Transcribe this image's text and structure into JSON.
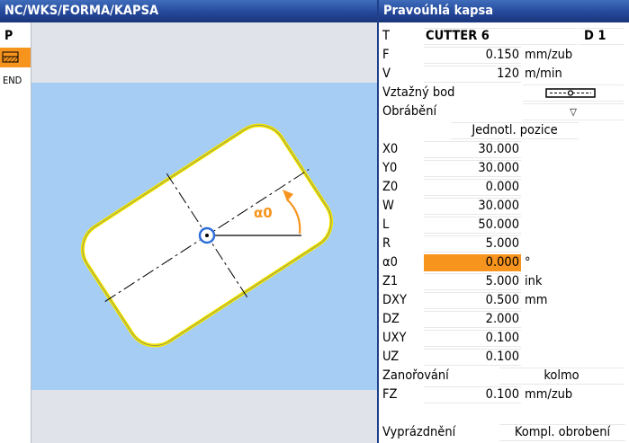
{
  "header": {
    "left_title": "NC/WKS/FORMA/KAPSA",
    "right_title": "Pravoúhlá kapsa"
  },
  "strip": {
    "p_label": "P",
    "pocket_icon": "pocket-milling-icon",
    "end_label": "END"
  },
  "graphic": {
    "angle_label": "α0"
  },
  "params": {
    "tool": {
      "label": "T",
      "value": "CUTTER 6",
      "edge": "D 1"
    },
    "feed": {
      "label": "F",
      "value": "0.150",
      "unit": "mm/zub"
    },
    "speed": {
      "label": "V",
      "value": "120",
      "unit": "m/min"
    },
    "reference_point": {
      "label": "Vztažný bod",
      "icon": "reference-point-center-icon"
    },
    "machining": {
      "label": "Obrábění",
      "icon": "chevron-down-icon",
      "value": "▽"
    },
    "position_mode": {
      "value": "Jednotl. pozice"
    },
    "x0": {
      "label": "X0",
      "value": "30.000"
    },
    "y0": {
      "label": "Y0",
      "value": "30.000"
    },
    "z0": {
      "label": "Z0",
      "value": "0.000"
    },
    "w": {
      "label": "W",
      "value": "30.000"
    },
    "l": {
      "label": "L",
      "value": "50.000"
    },
    "r": {
      "label": "R",
      "value": "5.000"
    },
    "alpha0": {
      "label": "α0",
      "value": "0.000",
      "unit": "°"
    },
    "z1": {
      "label": "Z1",
      "value": "5.000",
      "unit": "ink"
    },
    "dxy": {
      "label": "DXY",
      "value": "0.500",
      "unit": "mm"
    },
    "dz": {
      "label": "DZ",
      "value": "2.000"
    },
    "uxy": {
      "label": "UXY",
      "value": "0.100"
    },
    "uz": {
      "label": "UZ",
      "value": "0.100"
    },
    "plunging": {
      "label": "Zanořování",
      "value": "kolmo"
    },
    "fz": {
      "label": "FZ",
      "value": "0.100",
      "unit": "mm/zub"
    },
    "clearing": {
      "label": "Vyprázdnění",
      "value": "Kompl. obrobení"
    }
  },
  "colors": {
    "title_bar": "#25489a",
    "highlight": "#f7941d",
    "graphic_bg": "#a6cdf3",
    "pocket_outline": "#f2e600"
  }
}
